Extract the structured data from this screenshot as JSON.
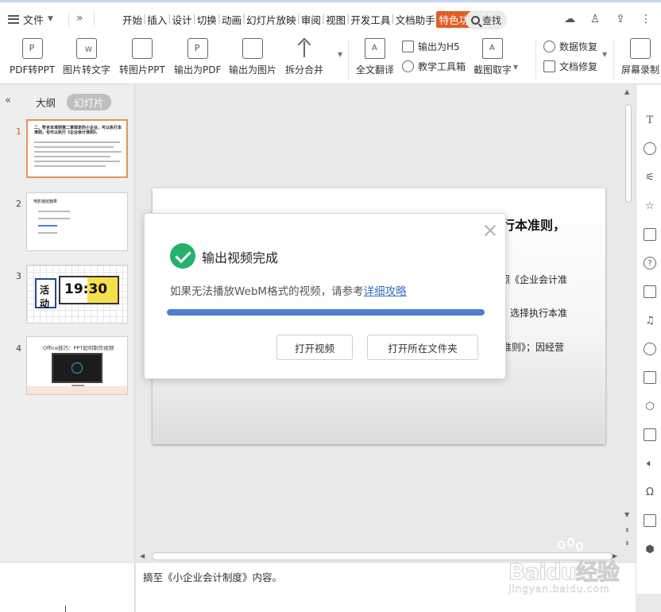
{
  "menubar": {
    "file_label": "文件",
    "tabs": [
      "开始",
      "插入",
      "设计",
      "切换",
      "动画",
      "幻灯片放映",
      "审阅",
      "视图",
      "开发工具",
      "文档助手"
    ],
    "active_tab": "特色功能",
    "search_label": "查找"
  },
  "ribbon": {
    "buttons": [
      "PDF转PPT",
      "图片转文字",
      "转图片PPT",
      "输出为PDF",
      "输出为图片",
      "拆分合并",
      "全文翻译"
    ],
    "small": {
      "export_h5": "输出为H5",
      "teaching_toolbox": "教学工具箱",
      "screenshot_ocr": "截图取字",
      "data_recovery": "数据恢复",
      "doc_repair": "文档修复",
      "screen_record": "屏幕录制"
    }
  },
  "left_panel": {
    "tab_outline": "大纲",
    "tab_slides": "幻灯片",
    "thumbnails": [
      {
        "num": "1",
        "title": "二、符合本准则第二章规定的小企业，可以执行本准则，也可以执行《企业会计准则》。"
      },
      {
        "num": "2",
        "title": "电影播放器果"
      },
      {
        "num": "3",
        "time": "19:30",
        "tag": "活动"
      },
      {
        "num": "4",
        "title": "Office技巧：PPT如何制作视频"
      }
    ]
  },
  "slide": {
    "heading_fragment": "行本准则，",
    "line1": "照《企业会计准",
    "line2": "，选择执行本准",
    "line3": "准则》；因经营"
  },
  "notes": {
    "text": "摘至《小企业会计制度》内容。"
  },
  "dialog": {
    "title": "输出视频完成",
    "message": "如果无法播放WebM格式的视频，请参考",
    "link": "详细攻略",
    "progress": 1.0,
    "btn_open": "打开视频",
    "btn_folder": "打开所在文件夹"
  },
  "watermark": {
    "brand": "Baidu经验",
    "url": "jingyan.baidu.com"
  },
  "colors": {
    "accent": "#e15d25",
    "progress": "#4b7fd1",
    "success": "#23b26b",
    "link": "#3a71c7"
  }
}
